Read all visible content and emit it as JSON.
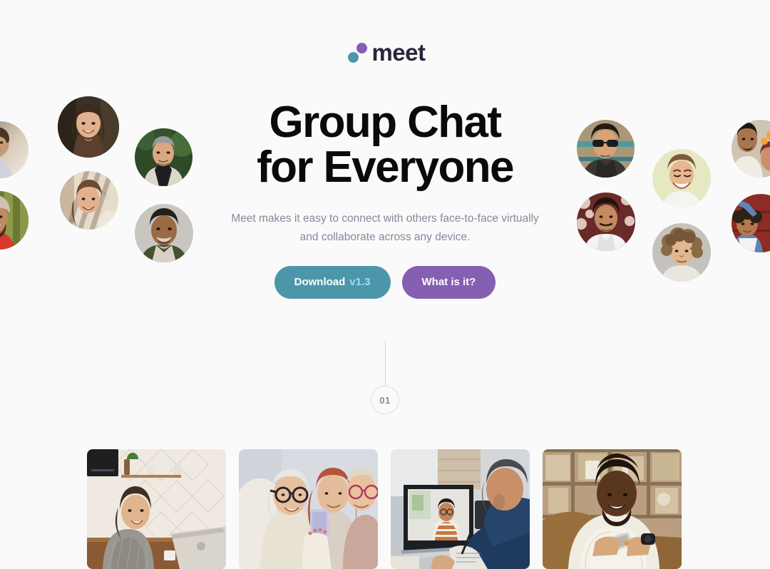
{
  "page": {
    "background_color": "#FAFAFA",
    "brand_teal": "#4D96A9",
    "brand_purple": "#855FB1",
    "text_dark": "#28283D",
    "text_muted": "#87879D",
    "version_accent": "#8FE3F9"
  },
  "logo": {
    "wordmark": "meet",
    "dot_purple_color": "#855FB1",
    "dot_teal_color": "#4D96A9"
  },
  "hero": {
    "title": "Group Chat\nfor Everyone",
    "subtitle": "Meet makes it easy to connect with others face-to-face virtually\nand collaborate across any device.",
    "buttons": {
      "download_label": "Download",
      "download_version": "v1.3",
      "what_label": "What is it?"
    }
  },
  "step_marker": {
    "number": "01"
  },
  "avatars": {
    "left": [
      {
        "name": "avatar-left-edge-top",
        "alt": "Young person at sunset"
      },
      {
        "name": "avatar-woman-hat",
        "alt": "Smiling woman with long brown hair"
      },
      {
        "name": "avatar-man-greenery",
        "alt": "Man with glasses in front of greenery"
      },
      {
        "name": "avatar-woman-shadows",
        "alt": "Smiling woman with hand in hair"
      },
      {
        "name": "avatar-left-edge-bottom",
        "alt": "Bearded man in red shirt"
      },
      {
        "name": "avatar-older-man",
        "alt": "Older man with grey moustache"
      }
    ],
    "right": [
      {
        "name": "avatar-man-sunglasses",
        "alt": "Man wearing sunglasses"
      },
      {
        "name": "avatar-man-laughing",
        "alt": "Laughing man on yellow background"
      },
      {
        "name": "avatar-right-edge-top",
        "alt": "Couple with flowers"
      },
      {
        "name": "avatar-man-flowers",
        "alt": "Man among flowers in white shirt"
      },
      {
        "name": "avatar-man-curly",
        "alt": "Young man with curly hair"
      },
      {
        "name": "avatar-right-edge-bottom",
        "alt": "Woman in denim jacket on red wall"
      }
    ]
  },
  "gallery": [
    {
      "name": "gallery-card-woman-laptop",
      "alt": "Woman smiling at laptop in kitchen"
    },
    {
      "name": "gallery-card-three-women-phone",
      "alt": "Three older women looking at a phone"
    },
    {
      "name": "gallery-card-video-call",
      "alt": "Man on a video call with laptop and documents"
    },
    {
      "name": "gallery-card-man-phone",
      "alt": "Smiling man looking at his phone on a sofa"
    }
  ]
}
